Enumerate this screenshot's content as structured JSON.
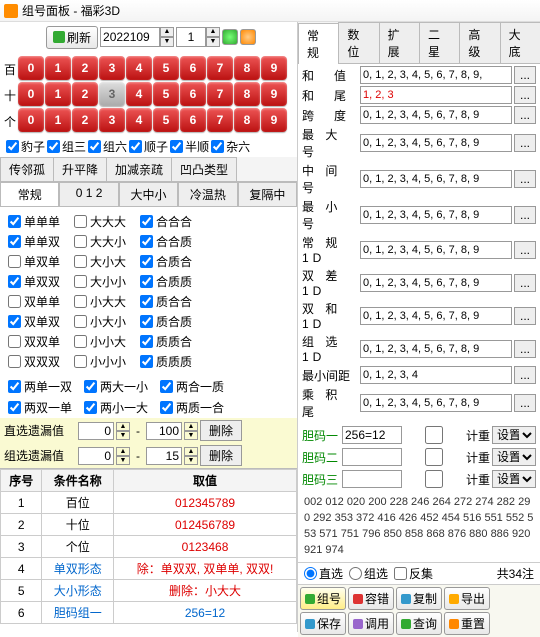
{
  "title": "组号面板 - 福彩3D",
  "toolbar": {
    "refresh": "刷新",
    "issue": "2022109",
    "index": "1"
  },
  "ball_labels": [
    "百",
    "十",
    "个"
  ],
  "balls": [
    {
      "digits": [
        "0",
        "1",
        "2",
        "3",
        "4",
        "5",
        "6",
        "7",
        "8",
        "9"
      ],
      "off": []
    },
    {
      "digits": [
        "0",
        "1",
        "2",
        "3",
        "4",
        "5",
        "6",
        "7",
        "8",
        "9"
      ],
      "off": [
        3
      ]
    },
    {
      "digits": [
        "0",
        "1",
        "2",
        "3",
        "4",
        "5",
        "6",
        "7",
        "8",
        "9"
      ],
      "off": []
    }
  ],
  "type_checks": [
    "豹子",
    "组三",
    "组六",
    "顺子",
    "半顺",
    "杂六"
  ],
  "group_tabs": [
    "传邻孤",
    "升平降",
    "加减亲疏",
    "凹凸类型"
  ],
  "sub_tabs": [
    "常规",
    "0 1 2",
    "大中小",
    "冷温热",
    "复隔中"
  ],
  "checkgrid": {
    "col1": [
      "单单单",
      "单单双",
      "单双单",
      "单双双",
      "双单单",
      "双单双",
      "双双单",
      "双双双"
    ],
    "col2": [
      "大大大",
      "大大小",
      "大小大",
      "大小小",
      "小大大",
      "小大小",
      "小小大",
      "小小小"
    ],
    "col3": [
      "合合合",
      "合合质",
      "合质合",
      "合质质",
      "质合合",
      "质合质",
      "质质合",
      "质质质"
    ]
  },
  "checkgrid_checked": {
    "col1": [
      true,
      true,
      false,
      true,
      false,
      true,
      false,
      false
    ],
    "col2": [
      false,
      false,
      false,
      false,
      false,
      false,
      false,
      false
    ],
    "col3": [
      true,
      true,
      true,
      true,
      true,
      true,
      true,
      true
    ]
  },
  "pairs": [
    [
      "两单一双",
      "两大一小",
      "两合一质"
    ],
    [
      "两双一单",
      "两小一大",
      "两质一合"
    ]
  ],
  "filters": [
    {
      "label": "直选遗漏值",
      "from": "0",
      "to": "100",
      "btn": "删除"
    },
    {
      "label": "组选遗漏值",
      "from": "0",
      "to": "15",
      "btn": "删除"
    }
  ],
  "cond_header": [
    "序号",
    "条件名称",
    "取值"
  ],
  "cond_rows": [
    {
      "n": "1",
      "name": "百位",
      "val": "012345789",
      "cls": "red"
    },
    {
      "n": "2",
      "name": "十位",
      "val": "012456789",
      "cls": "red"
    },
    {
      "n": "3",
      "name": "个位",
      "val": "0123468",
      "cls": "red"
    },
    {
      "n": "4",
      "name": "单双形态",
      "val": "除：单双双, 双单单, 双双!",
      "cls": "red",
      "nameCls": "blue"
    },
    {
      "n": "5",
      "name": "大小形态",
      "val": "删除：小大大",
      "cls": "red",
      "nameCls": "blue"
    },
    {
      "n": "6",
      "name": "胆码组一",
      "val": "256=12",
      "cls": "blue",
      "nameCls": "blue"
    }
  ],
  "right_tabs": [
    "常规",
    "数位",
    "扩展",
    "二星",
    "高级",
    "大底"
  ],
  "params": [
    {
      "label": "和　值",
      "val": "0, 1, 2, 3, 4, 5, 6, 7, 8, 9,",
      "cls": ""
    },
    {
      "label": "和　尾",
      "val": "1, 2, 3",
      "cls": "red"
    },
    {
      "label": "跨　度",
      "val": "0, 1, 2, 3, 4, 5, 6, 7, 8, 9",
      "cls": ""
    },
    {
      "label": "最 大 号",
      "val": "0, 1, 2, 3, 4, 5, 6, 7, 8, 9",
      "cls": ""
    },
    {
      "label": "中 间 号",
      "val": "0, 1, 2, 3, 4, 5, 6, 7, 8, 9",
      "cls": ""
    },
    {
      "label": "最 小 号",
      "val": "0, 1, 2, 3, 4, 5, 6, 7, 8, 9",
      "cls": ""
    },
    {
      "label": "常 规 1D",
      "val": "0, 1, 2, 3, 4, 5, 6, 7, 8, 9",
      "cls": ""
    },
    {
      "label": "双 差 1D",
      "val": "0, 1, 2, 3, 4, 5, 6, 7, 8, 9",
      "cls": ""
    },
    {
      "label": "双 和 1D",
      "val": "0, 1, 2, 3, 4, 5, 6, 7, 8, 9",
      "cls": ""
    },
    {
      "label": "组 选 1D",
      "val": "0, 1, 2, 3, 4, 5, 6, 7, 8, 9",
      "cls": ""
    },
    {
      "label": "最小间距",
      "val": "0, 1, 2, 3, 4",
      "cls": "",
      "tight": true
    },
    {
      "label": "乘 积 尾",
      "val": "0, 1, 2, 3, 4, 5, 6, 7, 8, 9",
      "cls": ""
    }
  ],
  "dan": [
    {
      "label": "胆码一",
      "val": "256=12",
      "chk": "计重",
      "sel": "设置"
    },
    {
      "label": "胆码二",
      "val": "",
      "chk": "计重",
      "sel": "设置"
    },
    {
      "label": "胆码三",
      "val": "",
      "chk": "计重",
      "sel": "设置"
    }
  ],
  "numbers": "002 012 020 200 228 246 264 272 274 282 290 292 353 372 416 426 452 454 516 551 552 553 571 751 796 850 858 868 876 880 886 920 921 974",
  "radios": {
    "a": "直选",
    "b": "组选",
    "c": "反集",
    "count": "共34注"
  },
  "actions": [
    {
      "t": "组号",
      "c": "g",
      "hi": true
    },
    {
      "t": "容错",
      "c": "r"
    },
    {
      "t": "复制",
      "c": "b"
    },
    {
      "t": "导出",
      "c": "y"
    },
    {
      "t": "保存",
      "c": "b"
    },
    {
      "t": "调用",
      "c": "p"
    },
    {
      "t": "查询",
      "c": "g"
    },
    {
      "t": "重置",
      "c": "o"
    }
  ]
}
